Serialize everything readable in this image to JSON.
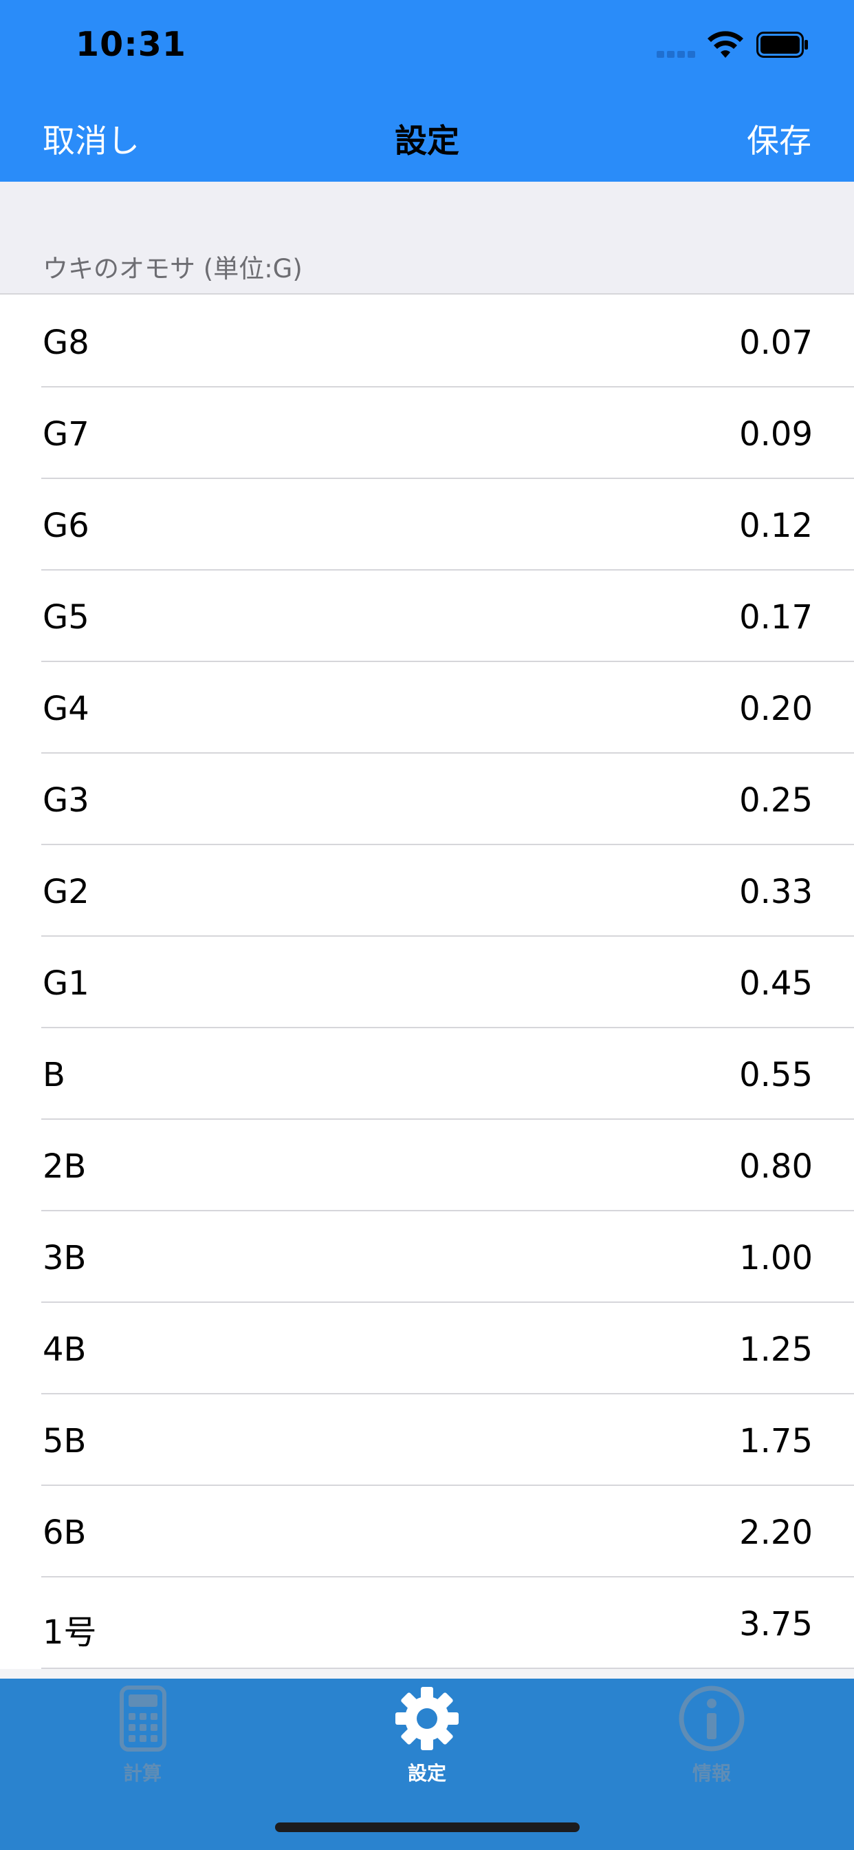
{
  "status_bar": {
    "time": "10:31",
    "icons": [
      "cellular-signal-icon",
      "wifi-icon",
      "battery-icon"
    ]
  },
  "nav": {
    "cancel_label": "取消し",
    "title": "設定",
    "save_label": "保存"
  },
  "section": {
    "title": "ウキのオモサ (単位:G)"
  },
  "rows": [
    {
      "label": "G8",
      "value": "0.07"
    },
    {
      "label": "G7",
      "value": "0.09"
    },
    {
      "label": "G6",
      "value": "0.12"
    },
    {
      "label": "G5",
      "value": "0.17"
    },
    {
      "label": "G4",
      "value": "0.20"
    },
    {
      "label": "G3",
      "value": "0.25"
    },
    {
      "label": "G2",
      "value": "0.33"
    },
    {
      "label": "G1",
      "value": "0.45"
    },
    {
      "label": "B",
      "value": "0.55"
    },
    {
      "label": "2B",
      "value": "0.80"
    },
    {
      "label": "3B",
      "value": "1.00"
    },
    {
      "label": "4B",
      "value": "1.25"
    },
    {
      "label": "5B",
      "value": "1.75"
    },
    {
      "label": "6B",
      "value": "2.20"
    },
    {
      "label": "1号",
      "value": "3.75"
    }
  ],
  "tabs": [
    {
      "label": "計算",
      "icon": "calculator-icon",
      "active": false
    },
    {
      "label": "設定",
      "icon": "gear-icon",
      "active": true
    },
    {
      "label": "情報",
      "icon": "info-icon",
      "active": false
    }
  ],
  "colors": {
    "nav_bar": "#2a8cf9",
    "tab_bar": "#2a83cf",
    "tab_active": "#ffffff",
    "tab_inactive": "#5f8db6",
    "section_background": "#efeff4",
    "separator": "#d6d6da"
  }
}
